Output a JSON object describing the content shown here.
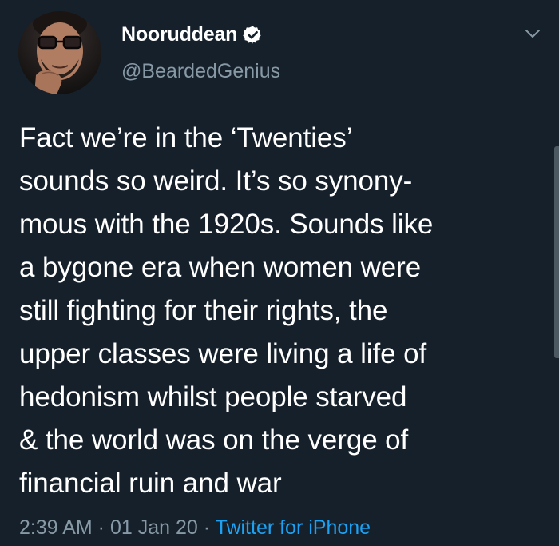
{
  "author": {
    "display_name": "Nooruddean",
    "handle": "@BeardedGenius",
    "verified": true
  },
  "tweet": {
    "text": "Fact we’re in the ‘Twenties’\nsounds so weird. It’s so synony-\nmous with the 1920s. Sounds like\na bygone era when women were\nstill fighting for their rights, the\nupper classes were living a life of\nhedonism whilst people starved\n& the world was on the verge of\nfinancial ruin and war"
  },
  "meta": {
    "time": "2:39 AM",
    "separator_1": " · ",
    "date": "01 Jan 20",
    "separator_2": " · ",
    "source": "Twitter for iPhone"
  },
  "icons": {
    "verified": "verified-badge-icon",
    "caret": "chevron-down-icon"
  },
  "colors": {
    "background": "#15202b",
    "primary_text": "#ffffff",
    "secondary_text": "#8899a6",
    "accent": "#1da1f2"
  }
}
